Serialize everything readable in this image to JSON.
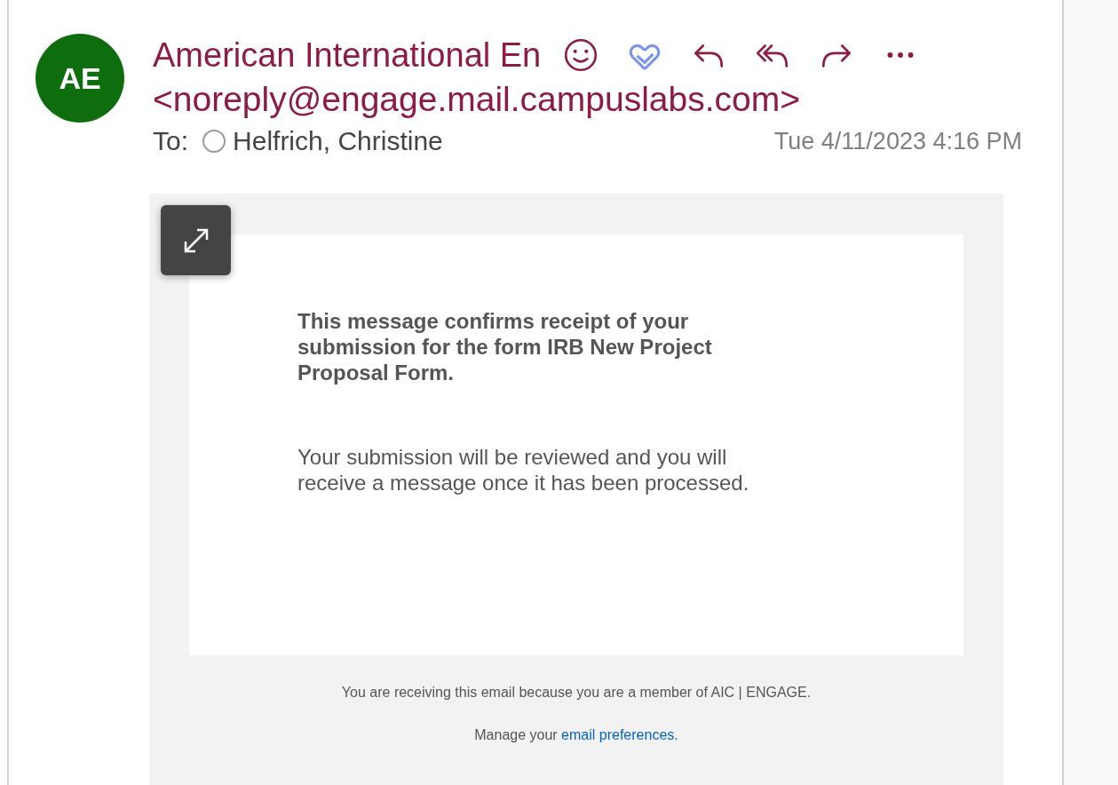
{
  "message": {
    "avatar_initials": "AE",
    "sender_name": "American International En",
    "sender_email": "<noreply@engage.mail.campuslabs.com>",
    "to_label": "To:",
    "recipient": "Helfrich, Christine",
    "date": "Tue 4/11/2023 4:16 PM"
  },
  "body": {
    "heading": "This message confirms receipt of your submission for the form IRB New Project Proposal Form.",
    "paragraph": "Your submission will be reviewed and you will receive a message once it has been processed."
  },
  "footer": {
    "notice": "You are receiving this email because you are a member of AIC | ENGAGE.",
    "manage_text": "Manage your ",
    "manage_link": "email preferences."
  }
}
